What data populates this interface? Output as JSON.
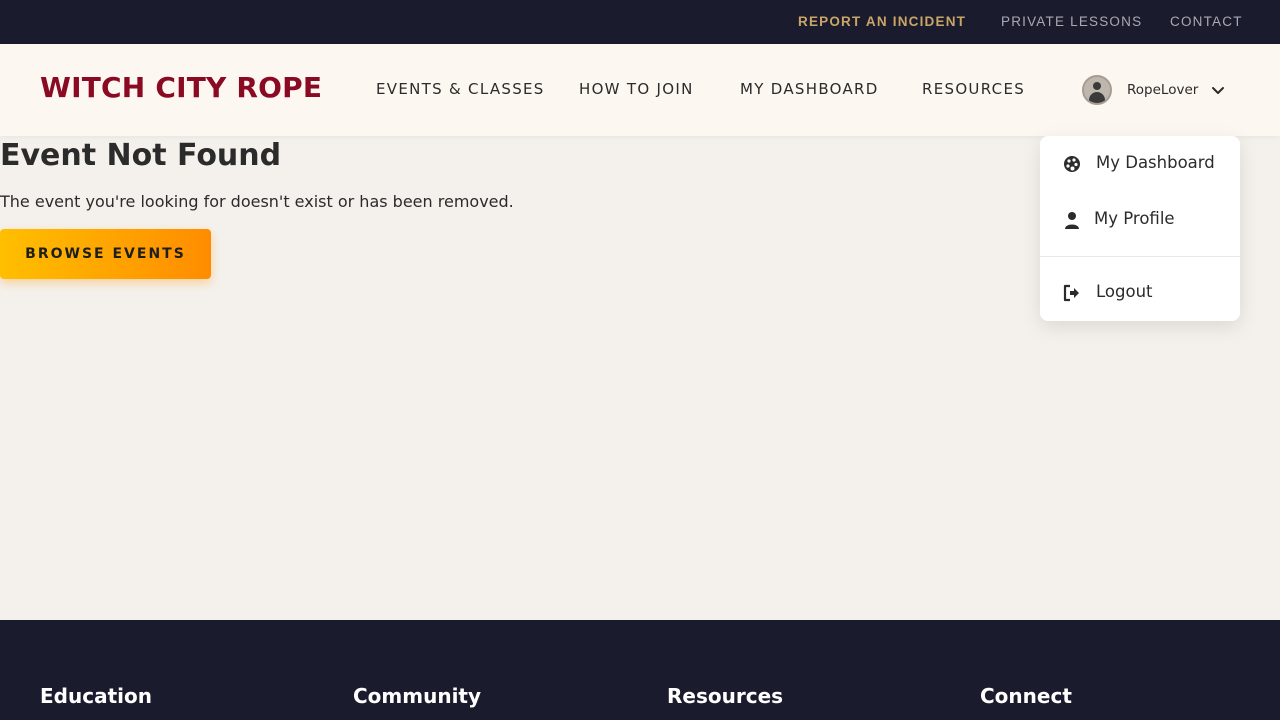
{
  "utility_bar": {
    "report_incident": "REPORT AN INCIDENT",
    "private_lessons": "PRIVATE LESSONS",
    "contact": "CONTACT"
  },
  "header": {
    "logo": "WITCH CITY ROPE",
    "nav": {
      "events_classes": "EVENTS & CLASSES",
      "how_to_join": "HOW TO JOIN",
      "my_dashboard": "MY DASHBOARD",
      "resources": "RESOURCES"
    },
    "user": {
      "name": "RopeLover"
    }
  },
  "user_dropdown": {
    "items": [
      {
        "label": "My Dashboard",
        "icon": "palette-icon"
      },
      {
        "label": "My Profile",
        "icon": "user-icon"
      },
      {
        "label": "Logout",
        "icon": "logout-icon"
      }
    ]
  },
  "main": {
    "title": "Event Not Found",
    "message": "The event you're looking for doesn't exist or has been removed.",
    "browse_button": "BROWSE EVENTS"
  },
  "footer": {
    "columns": [
      "Education",
      "Community",
      "Resources",
      "Connect"
    ]
  },
  "colors": {
    "brand": "#8b0a23",
    "dark_bar": "#1b1b2e",
    "incident_gold": "#c9a668",
    "button_gradient_start": "#ffbf00",
    "button_gradient_end": "#ff8c00",
    "page_background": "#f4f1ec",
    "header_background": "#fdf7f1"
  }
}
